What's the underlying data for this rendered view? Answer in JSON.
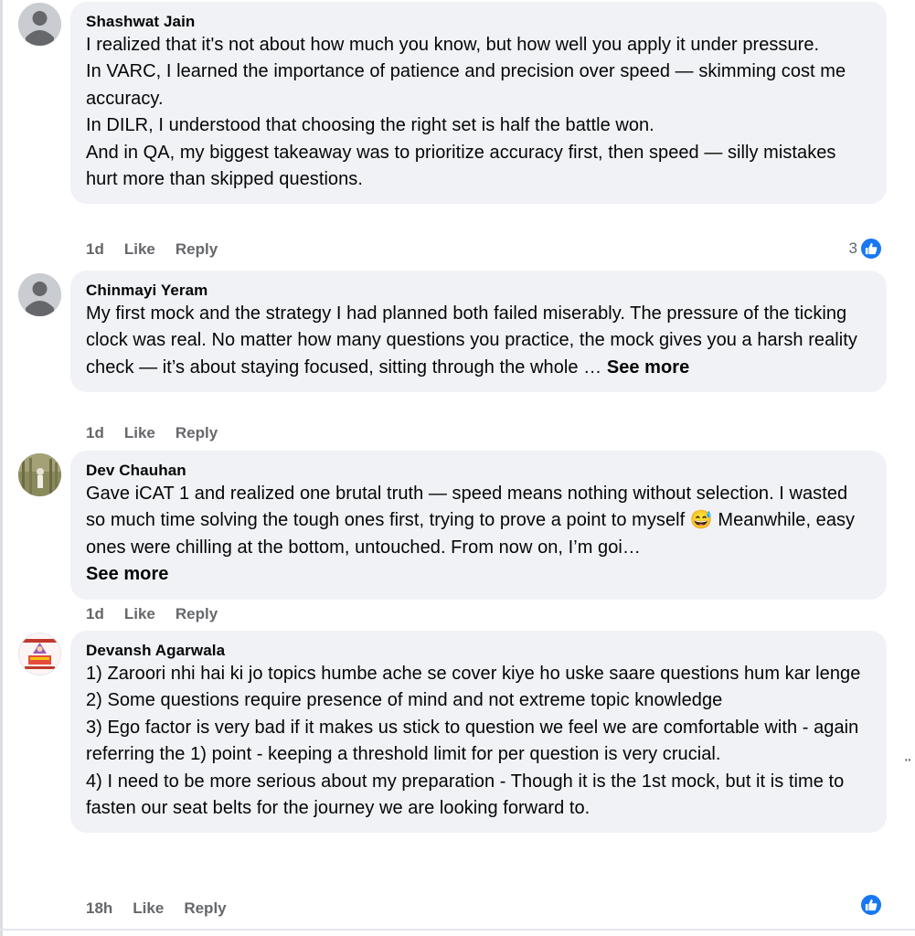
{
  "comments": [
    {
      "author": "Shashwat Jain",
      "lines": [
        "I realized that it's not about how much you know, but how well you apply it under pressure.",
        "In VARC, I learned the importance of patience and precision over speed — skimming cost me accuracy.",
        "In DILR, I understood that choosing the right set is half the battle won.",
        "And in QA, my biggest takeaway was to prioritize accuracy first, then speed — silly mistakes hurt more than skipped questions."
      ],
      "time": "1d",
      "like_label": "Like",
      "reply_label": "Reply",
      "reaction_count": "3"
    },
    {
      "author": "Chinmayi Yeram",
      "text": "My first mock and the strategy I had planned both failed miserably. The pressure of the ticking clock was real. No matter how many questions you practice, the mock gives you a harsh reality check — it’s about staying focused, sitting through the whole …",
      "see_more": "See more",
      "time": "1d",
      "like_label": "Like",
      "reply_label": "Reply"
    },
    {
      "author": "Dev Chauhan",
      "text": "Gave iCAT 1 and realized one brutal truth — speed means nothing without selection. I wasted so much time solving the tough ones first, trying to prove a point to myself 😅 Meanwhile, easy ones were chilling at the bottom, untouched. From now on, I’m goi…",
      "see_more": "See more",
      "time": "1d",
      "like_label": "Like",
      "reply_label": "Reply"
    },
    {
      "author": "Devansh Agarwala",
      "lines": [
        "1) Zaroori nhi hai ki jo topics humbe ache se cover kiye ho uske saare questions hum kar lenge",
        "2) Some questions require presence of mind and not extreme topic knowledge",
        "3) Ego factor is very bad if it makes us stick to question we feel we are comfortable with - again referring the 1) point - keeping a threshold limit for per question is very crucial.",
        "4) I need to be more serious about my preparation - Though it is the 1st mock, but it is time to fasten our seat belts for the journey we are looking forward to."
      ],
      "time": "18h",
      "like_label": "Like",
      "reply_label": "Reply"
    }
  ],
  "more_options": "··",
  "colors": {
    "bubble": "#f0f2f5",
    "meta": "#65676b",
    "like_blue": "#1877f2"
  }
}
